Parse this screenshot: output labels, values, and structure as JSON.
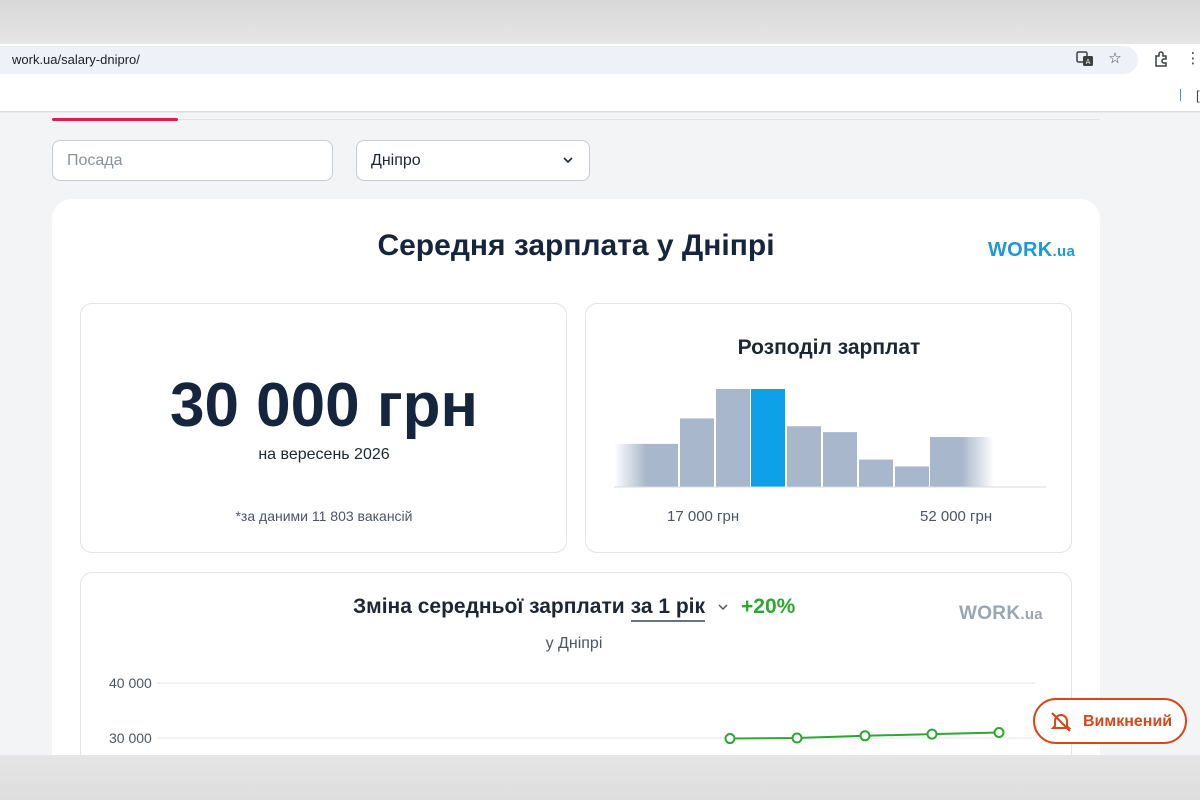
{
  "browser": {
    "url": "work.ua/salary-dnipro/",
    "icons": [
      "translate-icon",
      "star-icon",
      "extensions-icon",
      "menu-icon"
    ]
  },
  "filters": {
    "position_placeholder": "Посада",
    "city_value": "Дніпро"
  },
  "main": {
    "title": "Середня зарплата у Дніпрі",
    "logo_main": "WORK",
    "logo_suffix": ".ua",
    "logo_color": "#1c9ad6"
  },
  "summary": {
    "amount": "30 000 грн",
    "date": "на вересень 2026",
    "note": "*за даними 11 803 вакансій"
  },
  "distribution": {
    "title": "Розподіл зарплат",
    "min_label": "17 000 грн",
    "max_label": "52 000 грн",
    "bar_color": "#a9b7cc",
    "highlight_color": "#0ea0e9"
  },
  "change": {
    "title": "Зміна середньої зарплати",
    "period": "за 1 рік",
    "percent": "+20%",
    "subtitle": "у Дніпрі",
    "logo_main": "WORK",
    "logo_suffix": ".ua",
    "logo_color": "#9aa6b2",
    "line_color": "#2ba82f"
  },
  "chart_data": {
    "type": "line",
    "title": "Зміна середньої зарплати за 1 рік",
    "y_ticks": [
      "40 000",
      "30 000"
    ],
    "ylim": [
      20000,
      40000
    ],
    "values": [
      29900,
      30000,
      30400,
      30700,
      31000
    ],
    "series": [
      {
        "values": [
          29900,
          30000,
          30400,
          30700,
          31000
        ]
      }
    ],
    "grid": true
  },
  "histogram": {
    "type": "bar",
    "values": [
      0.44,
      0.7,
      1.0,
      1.0,
      0.62,
      0.56,
      0.28,
      0.21,
      0.51
    ],
    "highlight_index": 3
  },
  "fab": {
    "label": "Вимкнений"
  }
}
